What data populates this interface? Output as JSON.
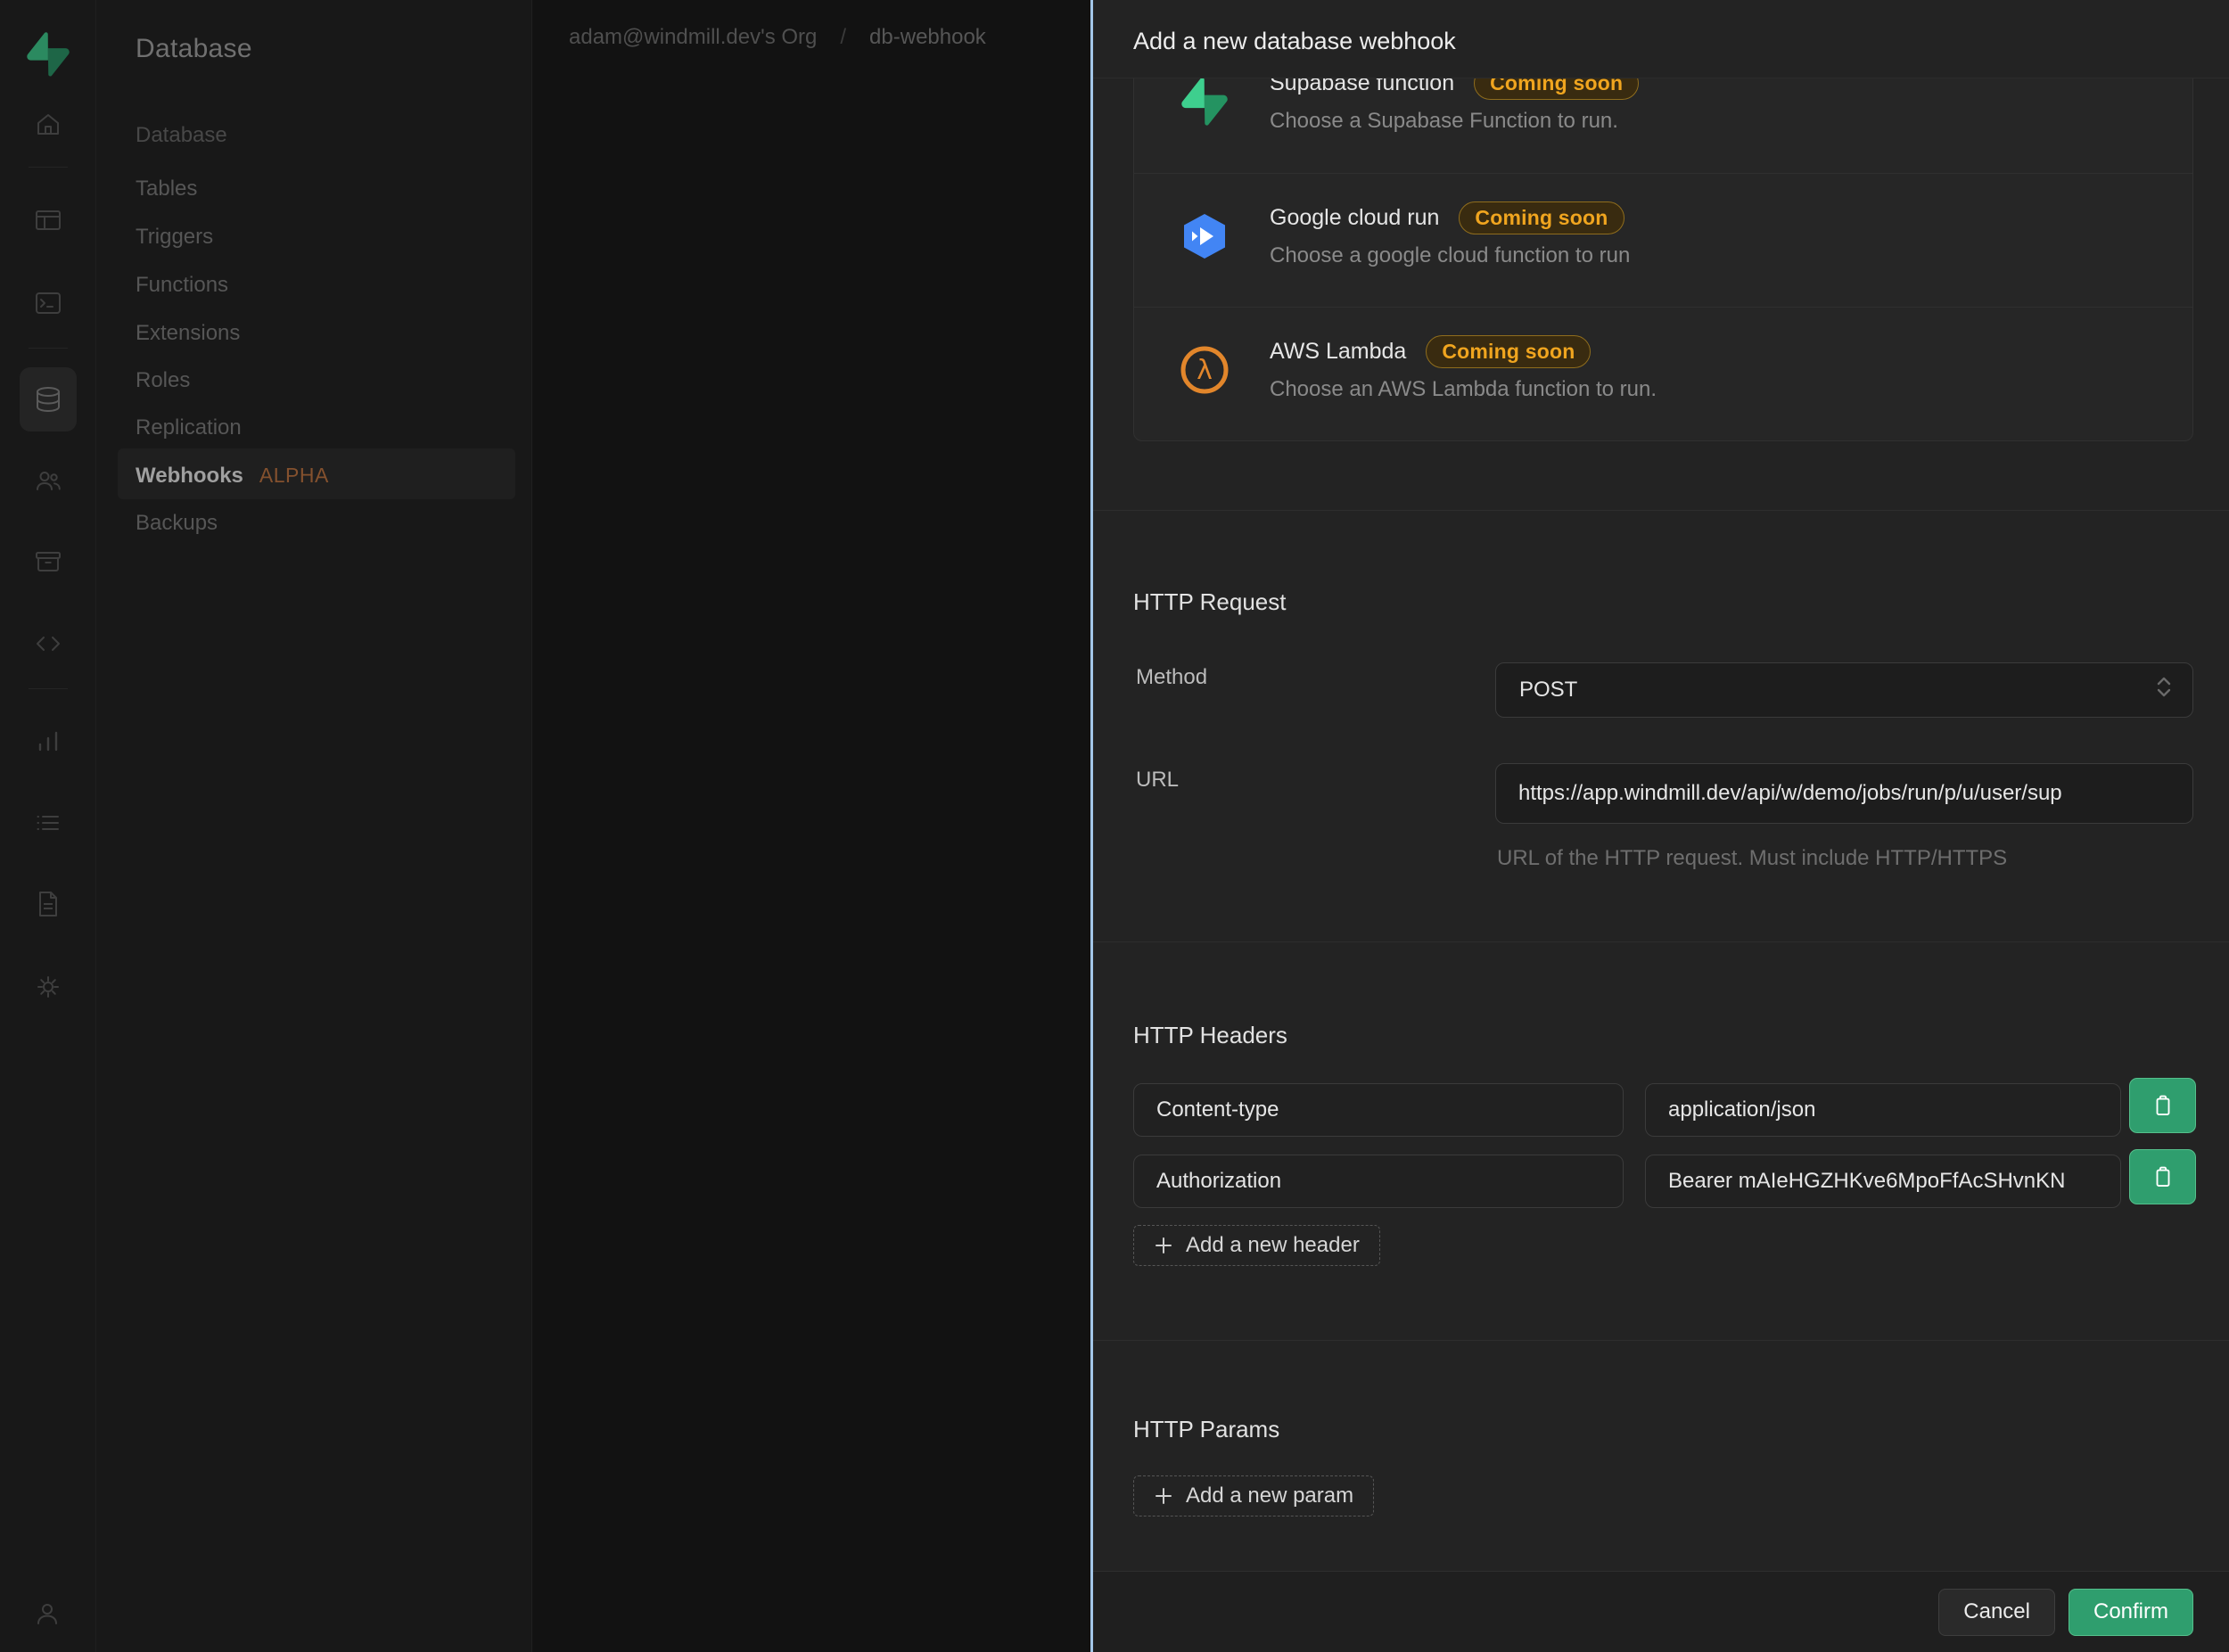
{
  "colors": {
    "brand_green": "#3ecf8e",
    "brand_green_dark": "#249361",
    "confirm_green": "#2f9e6e",
    "badge_amber_text": "#f0a51f",
    "panel_edge_blue": "#a3c6e8",
    "aws_orange": "#e2862b",
    "gcloud_blue": "#4285f4"
  },
  "topbar": {
    "page_title": "Database",
    "breadcrumb": {
      "org": "adam@windmill.dev's Org",
      "separator": "/",
      "project": "db-webhook"
    }
  },
  "rail": {
    "icons": [
      "home",
      "table-editor",
      "sql-editor",
      "database",
      "auth",
      "storage",
      "api",
      "reports",
      "logs",
      "docs",
      "settings",
      "profile"
    ],
    "active": "database"
  },
  "sidebar": {
    "section_label": "Database",
    "items": [
      {
        "label": "Tables"
      },
      {
        "label": "Triggers"
      },
      {
        "label": "Functions"
      },
      {
        "label": "Extensions"
      },
      {
        "label": "Roles"
      },
      {
        "label": "Replication"
      },
      {
        "label": "Webhooks",
        "badge": "ALPHA",
        "active": true
      },
      {
        "label": "Backups"
      }
    ]
  },
  "panel": {
    "title": "Add a new database webhook",
    "options": [
      {
        "title": "Supabase function",
        "badge": "Coming soon",
        "description": "Choose a Supabase Function to run.",
        "icon": "supabase"
      },
      {
        "title": "Google cloud run",
        "badge": "Coming soon",
        "description": "Choose a google cloud function to run",
        "icon": "google-cloud-run"
      },
      {
        "title": "AWS Lambda",
        "badge": "Coming soon",
        "description": "Choose an AWS Lambda function to run.",
        "icon": "aws-lambda"
      }
    ],
    "http_request": {
      "heading": "HTTP Request",
      "method_label": "Method",
      "method_value": "POST",
      "url_label": "URL",
      "url_value": "https://app.windmill.dev/api/w/demo/jobs/run/p/u/user/sup",
      "url_help": "URL of the HTTP request. Must include HTTP/HTTPS"
    },
    "http_headers": {
      "heading": "HTTP Headers",
      "rows": [
        {
          "key": "Content-type",
          "value": "application/json"
        },
        {
          "key": "Authorization",
          "value": "Bearer mAIeHGZHKve6MpoFfAcSHvnKN"
        }
      ],
      "add_label": "Add a new header"
    },
    "http_params": {
      "heading": "HTTP Params",
      "add_label": "Add a new param"
    },
    "footer": {
      "cancel_label": "Cancel",
      "confirm_label": "Confirm"
    }
  }
}
